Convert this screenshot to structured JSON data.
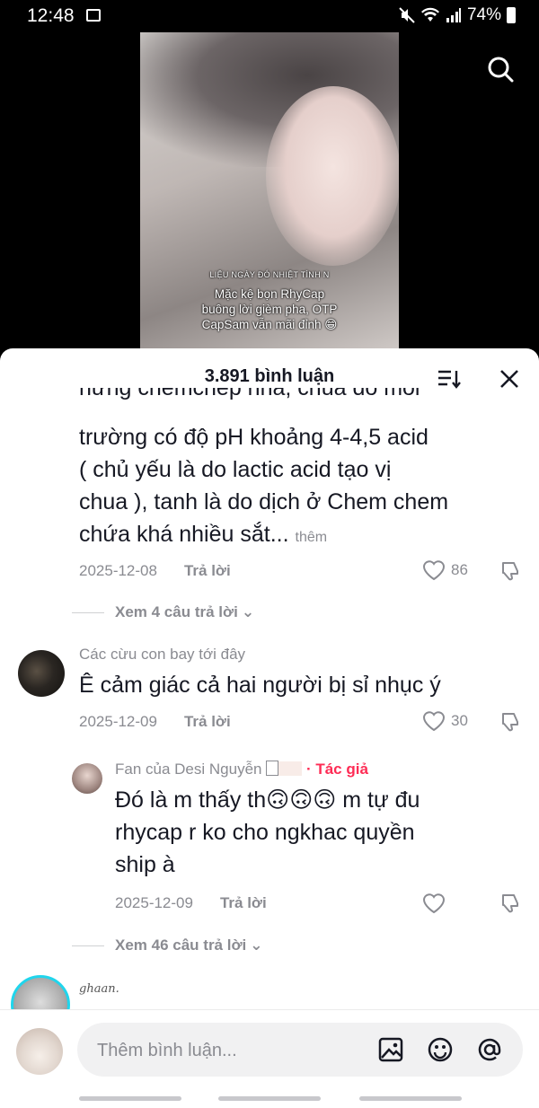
{
  "status_bar": {
    "time": "12:48",
    "battery": "74%"
  },
  "video": {
    "caption_small": "LIỆU NGÀY ĐÓ NHIỆT TÌNH N",
    "caption_line1": "Mặc kệ bọn RhyCap",
    "caption_line2": "buông lời gièm pha, OTP",
    "caption_line3": "CapSam vẫn mãi đỉnh 😁"
  },
  "sheet": {
    "title": "3.891 bình luận"
  },
  "comments": [
    {
      "cut_line": "hưng chemchep nha, chua do môi",
      "lines": [
        "trường có độ pH khoảng 4-4,5 acid",
        "( chủ yếu là do lactic acid tạo vị",
        "chua ), tanh là do dịch ở Chem chem",
        "chứa khá nhiều sắt..."
      ],
      "more": "thêm",
      "date": "2025-12-08",
      "reply_label": "Trả lời",
      "likes": "86",
      "view_replies": "Xem 4 câu trả lời"
    },
    {
      "username": "Các cừu con bay tới đây",
      "text": "Ê cảm giác cả hai người bị sỉ nhục ý",
      "date": "2025-12-09",
      "reply_label": "Trả lời",
      "likes": "30"
    },
    {
      "username": "Fan của Desi Nguyễn",
      "author_tag": "· Tác giả",
      "lines": [
        "Đó là m thấy th🙃🙃🙃 m tự đu",
        "rhycap r ko cho ngkhac quyền",
        "ship à"
      ],
      "date": "2025-12-09",
      "reply_label": "Trả lời",
      "view_replies": "Xem 46 câu trả lời"
    },
    {
      "username": "ghaan."
    }
  ],
  "input": {
    "placeholder": "Thêm bình luận..."
  }
}
